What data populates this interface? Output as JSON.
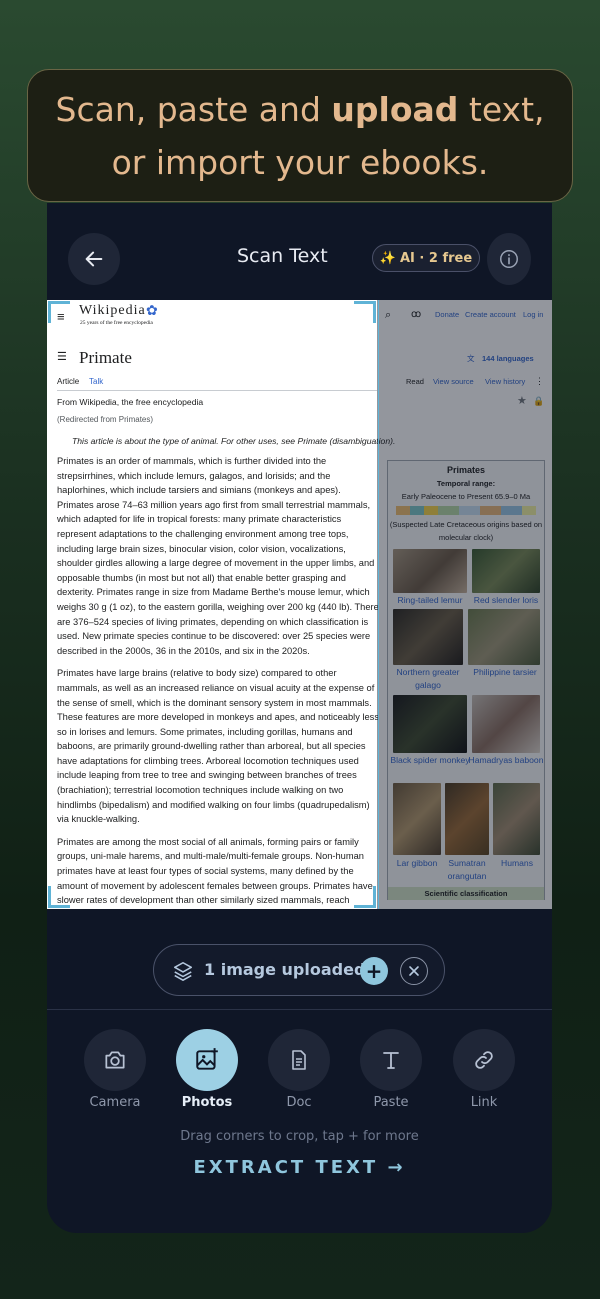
{
  "banner": {
    "line1_a": "Scan, paste and ",
    "line1_b": "upload",
    "line1_c": " text,",
    "line2": "or import your ebooks."
  },
  "header": {
    "title": "Scan Text",
    "ai_badge": "AI · 2 free"
  },
  "wiki": {
    "logo": "Wikipedia",
    "tagline": "25 years of the free encyclopedia",
    "top_links": [
      "Donate",
      "Create account",
      "Log in"
    ],
    "languages": "144 languages",
    "heading": "Primate",
    "tabs": [
      "Article",
      "Talk"
    ],
    "right_tabs": [
      "Read",
      "View source",
      "View history"
    ],
    "from": "From Wikipedia, the free encyclopedia",
    "redirected": "(Redirected from Primates)",
    "hatnote": "This article is about the type of animal. For other uses, see Primate (disambiguation).",
    "paragraphs": [
      "Primates is an order of mammals, which is further divided into the strepsirrhines, which include lemurs, galagos, and lorisids; and the haplorhines, which include tarsiers and simians (monkeys and apes). Primates arose 74–63 million years ago first from small terrestrial mammals, which adapted for life in tropical forests: many primate characteristics represent adaptations to the challenging environment among tree tops, including large brain sizes, binocular vision, color vision, vocalizations, shoulder girdles allowing a large degree of movement in the upper limbs, and opposable thumbs (in most but not all) that enable better grasping and dexterity. Primates range in size from Madame Berthe's mouse lemur, which weighs 30 g (1 oz), to the eastern gorilla, weighing over 200 kg (440 lb). There are 376–524 species of living primates, depending on which classification is used. New primate species continue to be discovered: over 25 species were described in the 2000s, 36 in the 2010s, and six in the 2020s.",
      "Primates have large brains (relative to body size) compared to other mammals, as well as an increased reliance on visual acuity at the expense of the sense of smell, which is the dominant sensory system in most mammals. These features are more developed in monkeys and apes, and noticeably less so in lorises and lemurs. Some primates, including gorillas, humans and baboons, are primarily ground-dwelling rather than arboreal, but all species have adaptations for climbing trees. Arboreal locomotion techniques used include leaping from tree to tree and swinging between branches of trees (brachiation); terrestrial locomotion techniques include walking on two hindlimbs (bipedalism) and modified walking on four limbs (quadrupedalism) via knuckle-walking.",
      "Primates are among the most social of all animals, forming pairs or family groups, uni-male harems, and multi-male/multi-female groups. Non-human primates have at least four types of social systems, many defined by the amount of movement by adolescent females between groups. Primates have slower rates of development than other similarly sized mammals, reach maturity later, and have longer lifespans. Primates are also the most cognitively"
    ],
    "infobox": {
      "title": "Primates",
      "range_label": "Temporal range:",
      "range_value": "Early Paleocene to Present 65.9–0 Ma",
      "suspected": "(Suspected Late Cretaceous origins based on molecular clock)",
      "captions": [
        "Ring-tailed lemur",
        "Red slender loris",
        "Northern greater galago",
        "Philippine tarsier",
        "Black spider monkey",
        "Hamadryas baboon",
        "Lar gibbon",
        "Sumatran orangutan",
        "Humans"
      ],
      "classification": "Scientific classification"
    }
  },
  "upload": {
    "label": "1 image uploaded"
  },
  "tools": [
    {
      "label": "Camera",
      "icon": "camera-icon"
    },
    {
      "label": "Photos",
      "icon": "photos-icon"
    },
    {
      "label": "Doc",
      "icon": "doc-icon"
    },
    {
      "label": "Paste",
      "icon": "text-icon"
    },
    {
      "label": "Link",
      "icon": "link-icon"
    }
  ],
  "hint": "Drag corners to crop, tap + for more",
  "extract": "EXTRACT TEXT →",
  "colors": {
    "accent": "#8fc6dd",
    "banner_text": "#e3b88e",
    "ai_badge": "#e6c890",
    "background": "#0f1626"
  }
}
